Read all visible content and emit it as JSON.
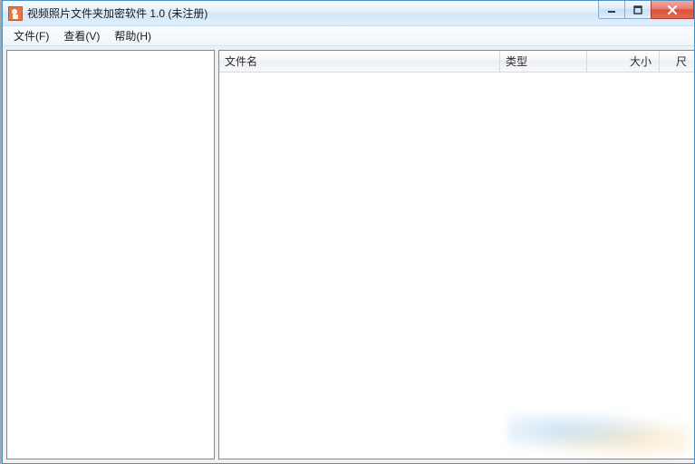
{
  "titlebar": {
    "title": "视频照片文件夹加密软件 1.0 (未注册)"
  },
  "menu": {
    "file": "文件(F)",
    "view": "查看(V)",
    "help": "帮助(H)"
  },
  "columns": {
    "name": "文件名",
    "type": "类型",
    "size": "大小",
    "extra": "尺"
  },
  "icons": {
    "minimize": "minimize-icon",
    "maximize": "maximize-icon",
    "close": "close-icon",
    "app": "lock-app-icon"
  }
}
